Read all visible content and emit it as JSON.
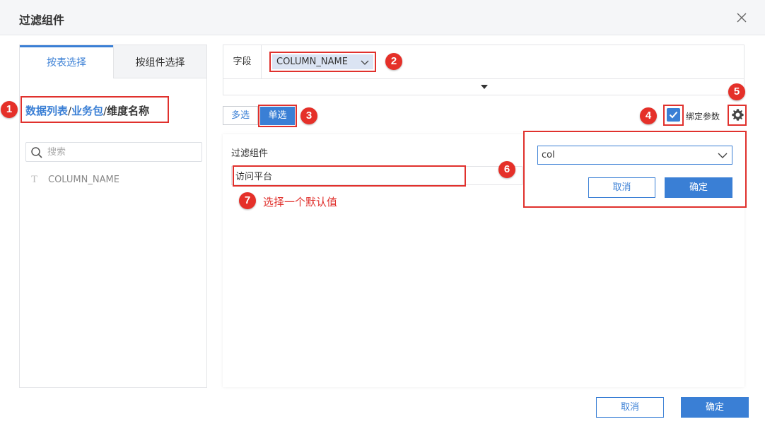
{
  "dialog": {
    "title": "过滤组件"
  },
  "left": {
    "tabs": [
      {
        "label": "按表选择",
        "active": true
      },
      {
        "label": "按组件选择",
        "active": false
      }
    ],
    "breadcrumb": {
      "part1": "数据列表",
      "sep1": "/",
      "part2": "业务包",
      "sep2": "/",
      "part3": "维度名称"
    },
    "search": {
      "placeholder": "搜索",
      "value": ""
    },
    "fields": [
      {
        "type_icon": "T",
        "name": "COLUMN_NAME"
      }
    ]
  },
  "field_row": {
    "label": "字段",
    "selected_field": "COLUMN_NAME"
  },
  "mode": {
    "multi_label": "多选",
    "single_label": "单选",
    "selected": "单选"
  },
  "bind_param": {
    "checked": true,
    "label": "绑定参数"
  },
  "filter": {
    "title": "过滤组件",
    "value": "访问平台"
  },
  "popup": {
    "select_value": "col",
    "cancel_label": "取消",
    "ok_label": "确定"
  },
  "annotations": {
    "m1": "1",
    "m2": "2",
    "m3": "3",
    "m4": "4",
    "m5": "5",
    "m6": "6",
    "m7": "7",
    "note7": "选择一个默认值"
  },
  "footer": {
    "cancel_label": "取消",
    "ok_label": "确定"
  },
  "colors": {
    "accent": "#3a7fd5",
    "highlight": "#e0312d",
    "marker": "#e53029"
  }
}
